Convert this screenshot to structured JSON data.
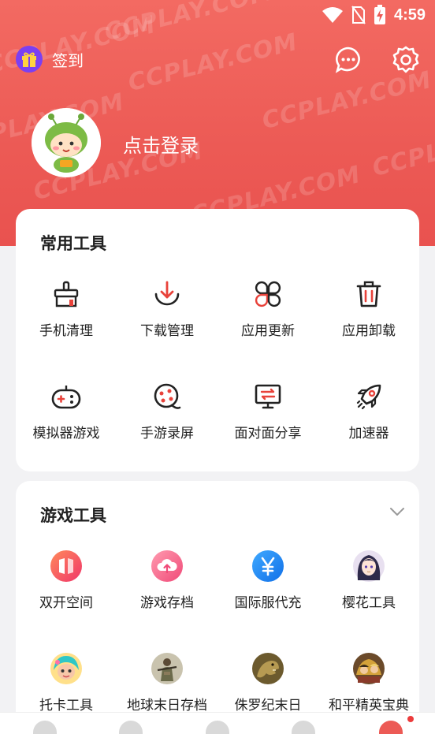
{
  "status_bar": {
    "time": "4:59"
  },
  "header": {
    "checkin_label": "签到",
    "login_prompt": "点击登录",
    "watermark_text": "CCPLAY.COM"
  },
  "colors": {
    "accent": "#ec5a55",
    "icon_red": "#e8423a"
  },
  "common_tools": {
    "title": "常用工具",
    "items": [
      {
        "label": "手机清理",
        "icon": "broom-icon"
      },
      {
        "label": "下载管理",
        "icon": "download-icon"
      },
      {
        "label": "应用更新",
        "icon": "apps-grid-icon"
      },
      {
        "label": "应用卸载",
        "icon": "trash-icon"
      },
      {
        "label": "模拟器游戏",
        "icon": "gamepad-icon"
      },
      {
        "label": "手游录屏",
        "icon": "film-reel-icon"
      },
      {
        "label": "面对面分享",
        "icon": "monitor-transfer-icon"
      },
      {
        "label": "加速器",
        "icon": "rocket-icon"
      }
    ]
  },
  "game_tools": {
    "title": "游戏工具",
    "items": [
      {
        "label": "双开空间",
        "icon": "dual-space-icon"
      },
      {
        "label": "游戏存档",
        "icon": "cloud-upload-icon"
      },
      {
        "label": "国际服代充",
        "icon": "yen-icon"
      },
      {
        "label": "樱花工具",
        "icon": "anime-girl-avatar"
      },
      {
        "label": "托卡工具",
        "icon": "toca-character-avatar"
      },
      {
        "label": "地球末日存档",
        "icon": "survivor-avatar"
      },
      {
        "label": "侏罗纪末日",
        "icon": "dinosaur-avatar"
      },
      {
        "label": "和平精英宝典",
        "icon": "soldier-avatar"
      }
    ]
  }
}
